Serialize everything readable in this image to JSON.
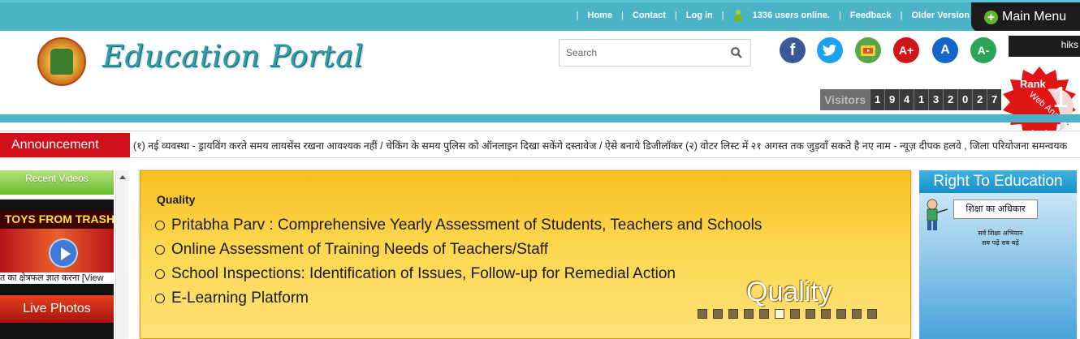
{
  "topbar": {
    "links": [
      "Home",
      "Contact",
      "Log in"
    ],
    "users_online": "1336 users online.",
    "feedback": "Feedback",
    "older_version": "Older Version",
    "main_menu": "Main Menu"
  },
  "header": {
    "site_title": "Education Portal",
    "search_placeholder": "Search",
    "social": {
      "facebook": "f",
      "font_increase": "A+",
      "font_reset": "A",
      "font_decrease": "A-"
    },
    "dark_tab_text": "hiks",
    "rank_badge": {
      "label": "Rank",
      "value": "1",
      "ribbon": "Web Analytics"
    },
    "visitors": {
      "label": "Visitors",
      "digits": [
        "1",
        "9",
        "4",
        "1",
        "3",
        "2",
        "0",
        "2",
        "7"
      ]
    }
  },
  "announcement": {
    "label": "Announcement",
    "text": "(१) नई व्यवस्था - ड्रायविंग करते समय लायसेंस रखना आवश्यक नहीं / चेकिंग के समय पुलिस को ऑनलाइन दिखा सकेंगे दस्तावेज / ऐसे बनाये डिजीलॉकर (२) वोटर लिस्ट में २१ अगस्त तक जुड़वाँ सकते है नए नाम - न्यूज़ दीपक हलवे , जिला परियोजना समन्वयक , ..."
  },
  "left": {
    "recent_videos": "Recent Videos",
    "video_title": "TOYS FROM TRASH",
    "video_caption": "त का क्षेत्रफल ज्ञात करना [View",
    "live_photos": "Live Photos"
  },
  "slider": {
    "heading": "Quality",
    "items": [
      "Pritabha Parv : Comprehensive Yearly Assessment of Students, Teachers and Schools",
      "Online Assessment of Training Needs of Teachers/Staff",
      "School Inspections: Identification of Issues, Follow-up for Remedial Action",
      "E-Learning Platform"
    ],
    "caption": "Quality",
    "pager_count": 12,
    "pager_active": 5
  },
  "right": {
    "title": "Right To Education",
    "card_text": "शिक्षा का अधिकार",
    "sub1": "सर्व शिक्षा अभियान",
    "sub2": "सब पढ़ें सब बढ़ें"
  },
  "colors": {
    "teal": "#4bb3c8",
    "announcement_red": "#d0111b",
    "slider_yellow": "#fcd54a",
    "rte_blue": "#178fcc"
  }
}
